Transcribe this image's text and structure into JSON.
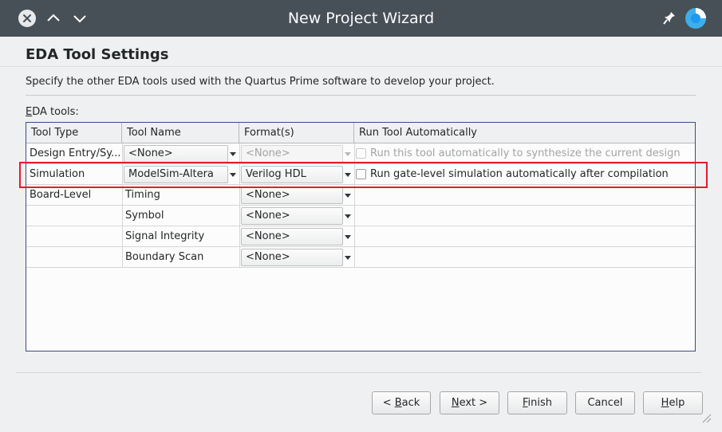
{
  "window": {
    "title": "New Project Wizard"
  },
  "page": {
    "title": "EDA Tool Settings",
    "description": "Specify the other EDA tools used with the Quartus Prime software to develop your project.",
    "eda_tools_label_prefix": "E",
    "eda_tools_label_rest": "DA tools:"
  },
  "table": {
    "headers": [
      "Tool Type",
      "Tool Name",
      "Format(s)",
      "Run Tool Automatically"
    ],
    "rows": [
      {
        "type": "Design Entry/Sy...",
        "name": "<None>",
        "format": "<None>",
        "run": "Run this tool automatically to synthesize the current design",
        "format_enabled": false,
        "run_enabled": false
      },
      {
        "type": "Simulation",
        "name": "ModelSim-Altera",
        "format": "Verilog HDL",
        "run": "Run gate-level simulation automatically after compilation",
        "format_enabled": true,
        "run_enabled": true
      },
      {
        "type": "Board-Level",
        "name": "Timing",
        "format": "<None>"
      },
      {
        "type": "",
        "name": "Symbol",
        "format": "<None>"
      },
      {
        "type": "",
        "name": "Signal Integrity",
        "format": "<None>"
      },
      {
        "type": "",
        "name": "Boundary Scan",
        "format": "<None>"
      }
    ]
  },
  "buttons": {
    "back": {
      "pre": "< ",
      "mnemonic": "B",
      "rest": "ack"
    },
    "next": {
      "mnemonic": "N",
      "rest": "ext >"
    },
    "finish": {
      "mnemonic": "F",
      "rest": "inish"
    },
    "cancel": {
      "label": "Cancel"
    },
    "help": {
      "mnemonic": "H",
      "rest": "elp"
    }
  },
  "colors": {
    "titlebar": "#475057",
    "highlight": "#e8192c",
    "table_border": "#3d4a86"
  }
}
